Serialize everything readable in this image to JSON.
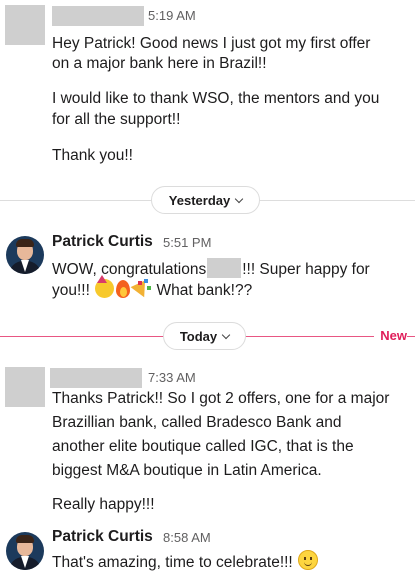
{
  "messages": [
    {
      "time": "5:19 AM",
      "lines": [
        "Hey Patrick! Good news I just got my first offer",
        "on a major bank here in Brazil!!",
        "I would like to thank WSO, the mentors and you",
        "for all the support!!",
        "Thank you!!"
      ]
    },
    {
      "author": "Patrick Curtis",
      "time": "5:51 PM",
      "line1_start": "WOW, congratulations",
      "line1_end": "!!!  Super happy for",
      "line2_start": "you!!!",
      "line2_end": "What bank!??"
    },
    {
      "time": "7:33 AM",
      "lines": [
        "Thanks Patrick!! So I got 2 offers, one for a major",
        "Brazillian bank, called Bradesco Bank and",
        "another elite boutique called IGC, that is the",
        "biggest M&A boutique in Latin America.",
        "Really happy!!!"
      ]
    },
    {
      "author": "Patrick Curtis",
      "time": "8:58 AM",
      "line": "That's amazing, time to celebrate!!!"
    }
  ],
  "dividers": {
    "yesterday": "Yesterday",
    "today": "Today",
    "new_label": "New"
  },
  "colors": {
    "new_marker": "#e01e5a",
    "text": "#1d1c1d",
    "timestamp": "#616061"
  },
  "icons": {
    "emoji_line2": [
      "partying-face-icon",
      "fire-icon",
      "party-popper-icon"
    ],
    "emoji_last": "slightly-smiling-face-icon"
  }
}
